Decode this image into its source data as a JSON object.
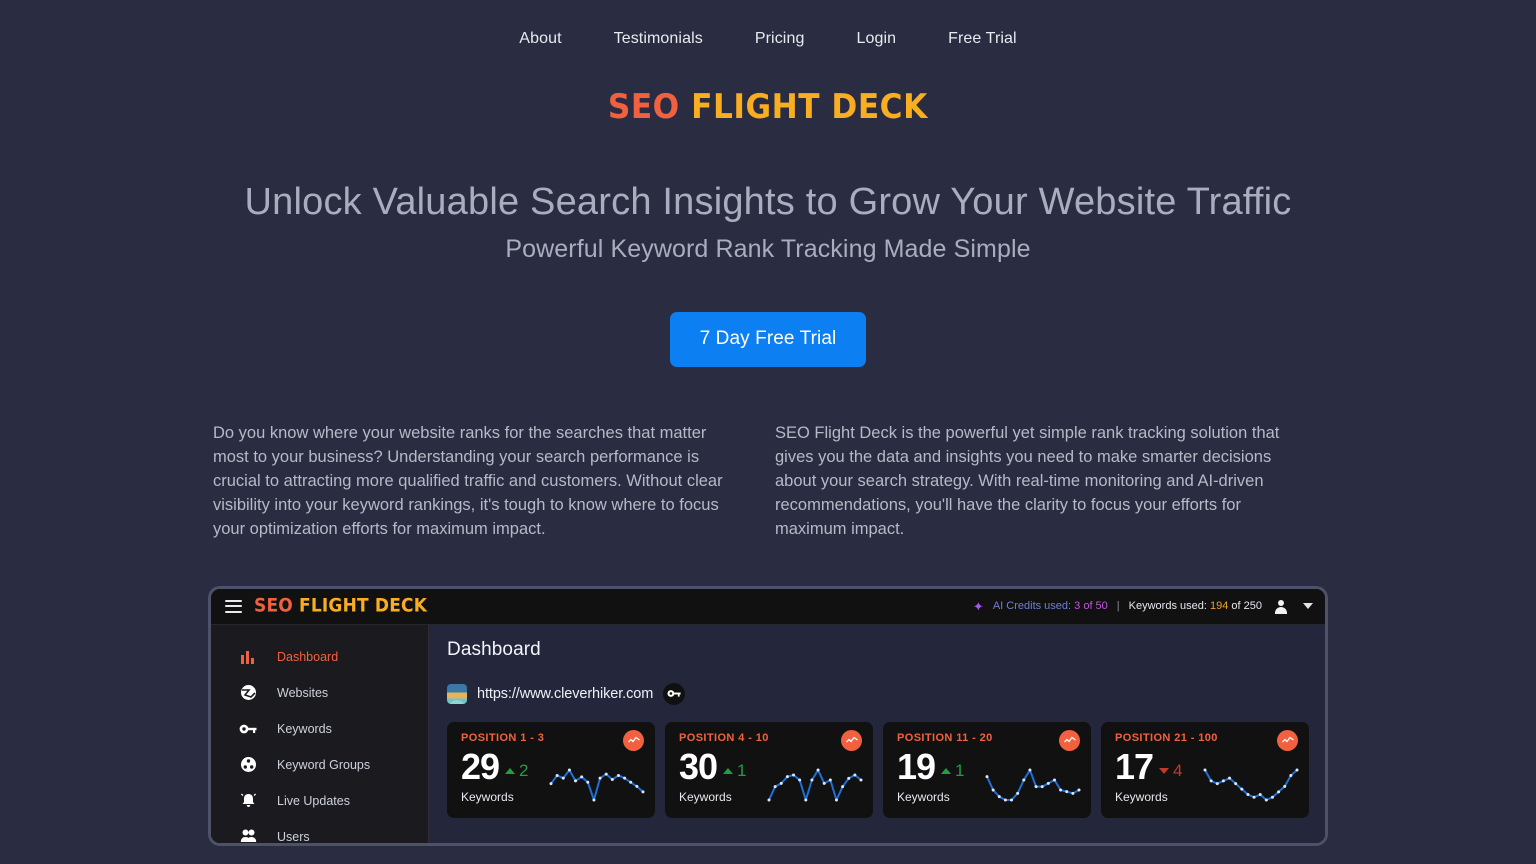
{
  "nav": {
    "items": [
      {
        "label": "About"
      },
      {
        "label": "Testimonials"
      },
      {
        "label": "Pricing"
      },
      {
        "label": "Login"
      },
      {
        "label": "Free Trial"
      }
    ]
  },
  "brand": {
    "part1": "SEO",
    "part2": "FLIGHT DECK",
    "color_part1": "#f2613f",
    "color_part2": "#f9ad20"
  },
  "hero": {
    "headline": "Unlock Valuable Search Insights to Grow Your Website Traffic",
    "subheadline": "Powerful Keyword Rank Tracking Made Simple",
    "cta_label": "7 Day Free Trial",
    "cta_color": "#0c7ff2"
  },
  "copy": {
    "left": "Do you know where your website ranks for the searches that matter most to your business? Understanding your search performance is crucial to attracting more qualified traffic and customers. Without clear visibility into your keyword rankings, it's tough to know where to focus your optimization efforts for maximum impact.",
    "right": "SEO Flight Deck is the powerful yet simple rank tracking solution that gives you the data and insights you need to make smarter decisions about your search strategy. With real-time monitoring and AI-driven recommendations, you'll have the clarity to focus your efforts for maximum impact."
  },
  "app": {
    "header": {
      "menu_icon": "hamburger-icon",
      "sparkle_icon": "sparkles-icon",
      "ai_credits_label": "AI Credits used:",
      "ai_credits_value": "3 of 50",
      "separator": "|",
      "keywords_label": "Keywords used:",
      "keywords_value": "194",
      "keywords_total": "of 250",
      "avatar_icon": "user-avatar-icon",
      "caret_icon": "chevron-down-icon"
    },
    "sidebar": {
      "items": [
        {
          "label": "Dashboard",
          "icon": "bar-chart-icon",
          "active": true
        },
        {
          "label": "Websites",
          "icon": "globe-icon",
          "active": false
        },
        {
          "label": "Keywords",
          "icon": "key-icon",
          "active": false
        },
        {
          "label": "Keyword Groups",
          "icon": "keyword-group-icon",
          "active": false
        },
        {
          "label": "Live Updates",
          "icon": "bell-icon",
          "active": false
        },
        {
          "label": "Users",
          "icon": "users-icon",
          "active": false
        }
      ]
    },
    "main": {
      "title": "Dashboard",
      "site": {
        "favicon": "cleverhiker-favicon",
        "url": "https://www.cleverhiker.com",
        "key_icon": "key-icon"
      },
      "cards": [
        {
          "title": "POSITION 1 - 3",
          "value": "29",
          "sub": "Keywords",
          "delta": "2",
          "direction": "up",
          "badge_icon": "trend-icon",
          "spark": [
            20,
            26,
            24,
            30,
            22,
            25,
            21,
            8,
            24,
            27,
            23,
            26,
            24,
            21,
            18,
            14
          ]
        },
        {
          "title": "POSITION 4 - 10",
          "value": "30",
          "sub": "Keywords",
          "delta": "1",
          "direction": "up",
          "badge_icon": "trend-icon",
          "spark": [
            12,
            20,
            22,
            26,
            27,
            24,
            12,
            24,
            30,
            22,
            24,
            12,
            20,
            25,
            27,
            24
          ]
        },
        {
          "title": "POSITION 11 - 20",
          "value": "19",
          "sub": "Keywords",
          "delta": "1",
          "direction": "up",
          "badge_icon": "trend-icon",
          "spark": [
            26,
            18,
            14,
            12,
            12,
            16,
            24,
            30,
            20,
            20,
            22,
            24,
            18,
            17,
            16,
            18
          ]
        },
        {
          "title": "POSITION 21 - 100",
          "value": "17",
          "sub": "Keywords",
          "delta": "4",
          "direction": "down",
          "badge_icon": "trend-icon",
          "spark": [
            30,
            22,
            20,
            22,
            24,
            20,
            16,
            12,
            10,
            12,
            8,
            10,
            14,
            18,
            26,
            30
          ]
        }
      ]
    }
  }
}
